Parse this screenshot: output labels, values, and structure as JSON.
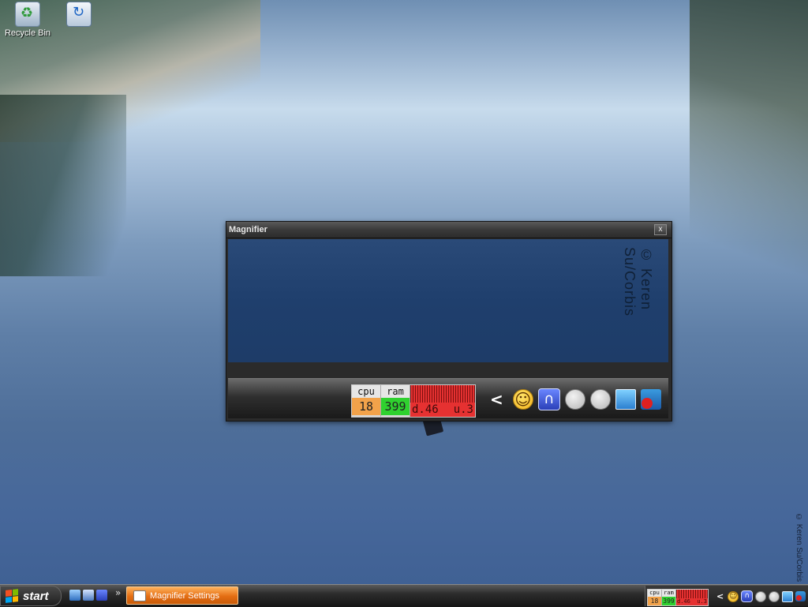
{
  "desktop": {
    "icons": [
      {
        "label": "Recycle Bin",
        "icon": "recycle-bin-icon"
      },
      {
        "label": "",
        "icon": "shortcut-icon"
      }
    ],
    "watermark": "© Keren Su/Corbis"
  },
  "magnifier": {
    "title": "Magnifier",
    "close_label": "x",
    "watermark": "© Keren Su/Corbis",
    "meter": {
      "cpu_label": "cpu",
      "cpu_value": "18",
      "ram_label": "ram",
      "ram_value": "399",
      "net_down": "d.46",
      "net_up": "u.3"
    },
    "tray_chevron": "<",
    "icons": [
      "smiley-icon",
      "arc-icon",
      "gray-circle-icon",
      "gray-circle-icon",
      "network-icon",
      "stop-badge-icon"
    ]
  },
  "taskbar": {
    "start_label": "start",
    "overflow": "»",
    "task_label": "Magnifier Settings",
    "meter": {
      "cpu_label": "cpu",
      "cpu_value": "18",
      "ram_label": "ram",
      "ram_value": "399",
      "net_down": "d.46",
      "net_up": "u.3"
    },
    "tray_chevron": "<"
  },
  "colors": {
    "task_button": "#e46d12",
    "cpu": "#f2a24a",
    "ram": "#2fd12f",
    "net": "#e63131"
  }
}
